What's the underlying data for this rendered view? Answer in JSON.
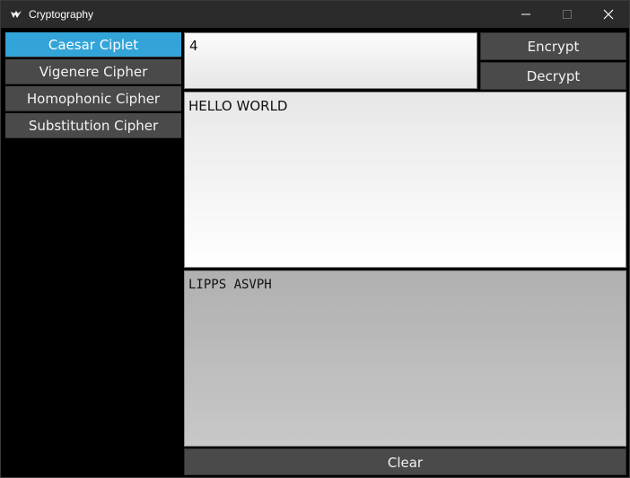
{
  "window": {
    "title": "Cryptography",
    "controls": {
      "minimize_icon": "minimize-icon",
      "maximize_icon": "maximize-icon",
      "close_icon": "close-icon"
    }
  },
  "sidebar": {
    "items": [
      {
        "label": "Caesar Ciplet",
        "active": true
      },
      {
        "label": "Vigenere Cipher",
        "active": false
      },
      {
        "label": "Homophonic Cipher",
        "active": false
      },
      {
        "label": "Substitution Cipher",
        "active": false
      }
    ]
  },
  "key": {
    "value": "4"
  },
  "actions": {
    "encrypt_label": "Encrypt",
    "decrypt_label": "Decrypt",
    "clear_label": "Clear"
  },
  "input": {
    "text": "HELLO WORLD"
  },
  "output": {
    "text": "LIPPS ASVPH"
  },
  "colors": {
    "accent": "#33a4d8",
    "button": "#4a4a4a",
    "background": "#000000",
    "titlebar": "#2b2b2b"
  }
}
